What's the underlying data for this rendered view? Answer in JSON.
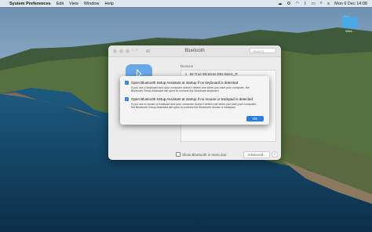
{
  "menubar": {
    "apple_icon": "apple-logo",
    "app_name": "System Preferences",
    "menus": [
      "Edit",
      "View",
      "Window",
      "Help"
    ],
    "datetime": "Mon 6 Dec  14:08"
  },
  "desktop": {
    "folder_label": "Wed..."
  },
  "bluetooth_window": {
    "title": "Bluetooth",
    "search_placeholder": "Search",
    "devices_label": "Devices",
    "devices": [
      {
        "name": "Mi True Wireless EBs Basic_R"
      }
    ],
    "show_in_menubar_label": "Show Bluetooth in menu bar",
    "advanced_label": "Advanced...",
    "help_label": "?"
  },
  "sheet": {
    "option1": {
      "label": "Open Bluetooth Setup Assistant at startup if no keyboard is detected",
      "description": "If you use a keyboard and your computer doesn't detect one when you start your computer, the Bluetooth Setup Assistant will open to connect the Bluetooth keyboard.",
      "checked": true
    },
    "option2": {
      "label": "Open Bluetooth Setup Assistant at startup if no mouse or trackpad is detected",
      "description": "If you use a mouse or trackpad and your computer doesn't detect one when you start your computer, the Bluetooth Setup Assistant will open to connect the Bluetooth mouse or trackpad.",
      "checked": true
    },
    "ok_label": "OK"
  },
  "colors": {
    "accent": "#2a7de1",
    "bluetooth_icon_bg": "#69a9ea"
  }
}
